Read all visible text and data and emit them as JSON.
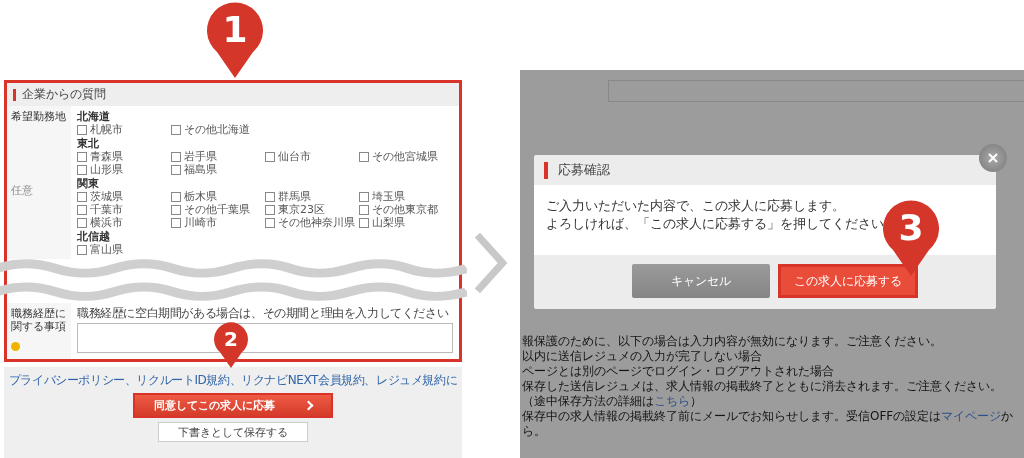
{
  "step_markers": [
    {
      "label": "1"
    },
    {
      "label": "2"
    },
    {
      "label": "3"
    }
  ],
  "left_screen": {
    "section_title": "企業からの質問",
    "field_label": "希望勤務地",
    "field_badge": "任意",
    "regions": [
      {
        "name": "北海道",
        "options": [
          {
            "label": "札幌市",
            "checked": false
          },
          {
            "label": "その他北海道",
            "checked": false
          }
        ]
      },
      {
        "name": "東北",
        "options": [
          {
            "label": "青森県",
            "checked": false
          },
          {
            "label": "岩手県",
            "checked": false
          },
          {
            "label": "仙台市",
            "checked": false
          },
          {
            "label": "その他宮城県",
            "checked": false
          },
          {
            "label": "山形県",
            "checked": false
          },
          {
            "label": "福島県",
            "checked": false
          }
        ]
      },
      {
        "name": "関東",
        "options": [
          {
            "label": "茨城県",
            "checked": false
          },
          {
            "label": "栃木県",
            "checked": false
          },
          {
            "label": "群馬県",
            "checked": false
          },
          {
            "label": "埼玉県",
            "checked": false
          },
          {
            "label": "千葉市",
            "checked": false
          },
          {
            "label": "その他千葉県",
            "checked": false
          },
          {
            "label": "東京23区",
            "checked": false
          },
          {
            "label": "その他東京都",
            "checked": false
          },
          {
            "label": "横浜市",
            "checked": false
          },
          {
            "label": "川崎市",
            "checked": false
          },
          {
            "label": "その他神奈川県",
            "checked": false
          },
          {
            "label": "山梨県",
            "checked": false
          }
        ]
      },
      {
        "name": "北信越",
        "options": [
          {
            "label": "富山県",
            "checked": false
          }
        ]
      }
    ],
    "career_label": "職務経歴に関する事項",
    "career_hint": "職務経歴に空白期間がある場合は、その期間と理由を入力してください",
    "terms_text": "プライバシーポリシー、リクルートID規約、リクナビNEXT会員規約、レジュメ規約に",
    "apply_button": "同意してこの求人に応募",
    "draft_button": "下書きとして保存する"
  },
  "right_screen": {
    "modal": {
      "title": "応募確認",
      "message": [
        "ご入力いただいた内容で、この求人に応募します。",
        "よろしければ、「この求人に応募する」を押してください"
      ],
      "cancel_button": "キャンセル",
      "confirm_button": "この求人に応募する"
    },
    "notes": [
      {
        "text": "報保護のために、以下の場合は入力内容が無効になります。ご注意ください。"
      },
      {
        "text": "以内に送信レジュメの入力が完了しない場合"
      },
      {
        "text": "ページとは別のページでログイン・ログアウトされた場合"
      },
      {
        "text": "保存した送信レジュメは、求人情報の掲載終了とともに消去されます。ご注意ください。（途中保存方法の詳細は",
        "link": "こちら",
        "after": "）"
      },
      {
        "text": "保存中の求人情報の掲載終了前にメールでお知らせします。受信OFFの設定は",
        "link": "マイページ",
        "after": "から。"
      }
    ]
  }
}
